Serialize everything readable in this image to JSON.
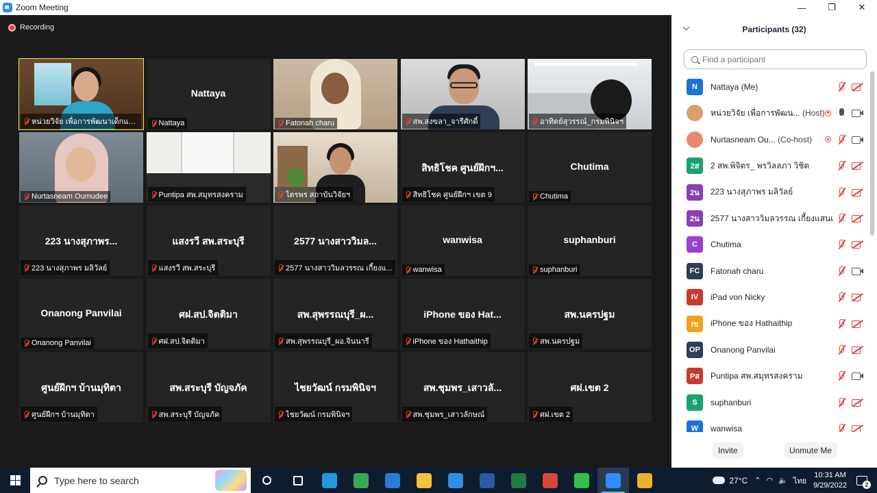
{
  "window": {
    "title": "Zoom Meeting",
    "controls": [
      "—",
      "❐",
      "✕"
    ]
  },
  "recording": {
    "label": "Recording"
  },
  "gallery": [
    {
      "big": "",
      "label": "หน่วยวิจัย เพื่อการพัฒนาเด็กและเยา...",
      "video": "v1"
    },
    {
      "big": "Nattaya",
      "label": "Nattaya",
      "video": ""
    },
    {
      "big": "",
      "label": "Fatonah charu",
      "video": "v3"
    },
    {
      "big": "",
      "label": "สพ.สงขลา_จารีศักดิ์",
      "video": "v4"
    },
    {
      "big": "",
      "label": "อาทิตย์สุวรรณ์_กรมพินิจฯ",
      "video": "v5"
    },
    {
      "big": "",
      "label": "Nurtasneam Oumudee",
      "video": "v6"
    },
    {
      "big": "",
      "label": "Puntipa สพ.สมุทรสงคราม",
      "video": "v7"
    },
    {
      "big": "",
      "label": "ไตรพร สถาบันวิจัยฯ",
      "video": "v8"
    },
    {
      "big": "สิทธิโชค ศูนย์ฝึกฯ...",
      "label": "สิทธิโชค ศูนย์ฝึกฯ เขต 9",
      "video": ""
    },
    {
      "big": "Chutima",
      "label": "Chutima",
      "video": ""
    },
    {
      "big": "223 นางสุภาพร...",
      "label": "223 นางสุภาพร  มลิวัลย์",
      "video": ""
    },
    {
      "big": "แสงรวี สพ.สระบุรี",
      "label": "แสงรวี สพ.สระบุรี",
      "video": ""
    },
    {
      "big": "2577 นางสาววิมล...",
      "label": "2577 นางสาววิมลวรรณ เกี้ยงแ...",
      "video": ""
    },
    {
      "big": "wanwisa",
      "label": "wanwisa",
      "video": ""
    },
    {
      "big": "suphanburi",
      "label": "suphanburi",
      "video": ""
    },
    {
      "big": "Onanong Panvilai",
      "label": "Onanong Panvilai",
      "video": ""
    },
    {
      "big": "ศฝ.สป.จิตติมา",
      "label": "ศฝ.สป.จิตติมา",
      "video": ""
    },
    {
      "big": "สพ.สุพรรณบุรี_ผ...",
      "label": "สพ.สุพรรณบุรี_ผอ.จินนารี",
      "video": ""
    },
    {
      "big": "iPhone ของ Hat...",
      "label": "iPhone ของ Hathaithip",
      "video": ""
    },
    {
      "big": "สพ.นครปฐม",
      "label": "สพ.นครปฐม",
      "video": ""
    },
    {
      "big": "ศูนย์ฝึกฯ บ้านมุทิตา",
      "label": "ศูนย์ฝึกฯ บ้านมุทิตา",
      "video": ""
    },
    {
      "big": "สพ.สระบุรี บัญจภัค",
      "label": "สพ.สระบุรี บัญจภัค",
      "video": ""
    },
    {
      "big": "ไชยวัฒน์ กรมพินิจฯ",
      "label": "ไชยวัฒน์ กรมพินิจฯ",
      "video": ""
    },
    {
      "big": "สพ.ชุมพร_เสาวลั...",
      "label": "สพ.ชุมพร_เสาวลักษณ์",
      "video": ""
    },
    {
      "big": "ศฝ.เขต 2",
      "label": "ศฝ.เขต 2",
      "video": ""
    }
  ],
  "participants": {
    "title": "Participants (32)",
    "search_placeholder": "Find a participant",
    "items": [
      {
        "avatar": "N",
        "color": "#1b72d8",
        "name": "Nattaya (Me)",
        "role": "",
        "rec": false,
        "mic": "muted",
        "cam": "off"
      },
      {
        "avatar": "",
        "color": "#d9a06b",
        "name": "หน่วยวิจัย เพื่อการพัฒน...",
        "role": "(Host)",
        "rec": true,
        "mic": "on",
        "cam": "on"
      },
      {
        "avatar": "",
        "color": "#e88a6a",
        "name": "Nurtasneam Ou...",
        "role": "(Co-host)",
        "rec": true,
        "mic": "muted",
        "cam": "on"
      },
      {
        "avatar": "2ส",
        "color": "#1aa36f",
        "name": "2 สพ.พิจิตร_ พรวิลลภา วิชิต",
        "role": "",
        "rec": false,
        "mic": "muted",
        "cam": "off"
      },
      {
        "avatar": "2น",
        "color": "#8a3fb5",
        "name": "223 นางสุภาพร  มลิวัลย์",
        "role": "",
        "rec": false,
        "mic": "muted",
        "cam": "off"
      },
      {
        "avatar": "2น",
        "color": "#8a3fb5",
        "name": "2577 นางสาววิมลวรรณ เกี้ยงแสนเมือง",
        "role": "",
        "rec": false,
        "mic": "muted",
        "cam": "off"
      },
      {
        "avatar": "C",
        "color": "#9a3fd0",
        "name": "Chutima",
        "role": "",
        "rec": false,
        "mic": "muted",
        "cam": "off"
      },
      {
        "avatar": "FC",
        "color": "#2d3e57",
        "name": "Fatonah charu",
        "role": "",
        "rec": false,
        "mic": "muted",
        "cam": "on"
      },
      {
        "avatar": "IV",
        "color": "#c93a2c",
        "name": "iPad von Nicky",
        "role": "",
        "rec": false,
        "mic": "muted",
        "cam": "off"
      },
      {
        "avatar": "Iข",
        "color": "#f0a21a",
        "name": "iPhone ของ Hathaithip",
        "role": "",
        "rec": false,
        "mic": "muted",
        "cam": "off"
      },
      {
        "avatar": "OP",
        "color": "#2d3e57",
        "name": "Onanong Panvilai",
        "role": "",
        "rec": false,
        "mic": "muted",
        "cam": "off"
      },
      {
        "avatar": "Pส",
        "color": "#c93a2c",
        "name": "Puntipa สพ.สมุทรสงคราม",
        "role": "",
        "rec": false,
        "mic": "muted",
        "cam": "on"
      },
      {
        "avatar": "S",
        "color": "#1aa36f",
        "name": "suphanburi",
        "role": "",
        "rec": false,
        "mic": "muted",
        "cam": "off"
      },
      {
        "avatar": "W",
        "color": "#1b72d8",
        "name": "wanwisa",
        "role": "",
        "rec": false,
        "mic": "muted",
        "cam": "off"
      }
    ],
    "invite_label": "Invite",
    "unmute_label": "Unmute Me"
  },
  "taskbar": {
    "search_placeholder": "Type here to search",
    "apps": [
      {
        "name": "edge-icon",
        "color": "#1f9ae0"
      },
      {
        "name": "chrome-icon",
        "color": "#3aa757"
      },
      {
        "name": "store-icon",
        "color": "#2b7bd6"
      },
      {
        "name": "file-explorer-icon",
        "color": "#f3c23d"
      },
      {
        "name": "mail-icon",
        "color": "#2f8fe0"
      },
      {
        "name": "word-icon",
        "color": "#2a5aa8"
      },
      {
        "name": "excel-icon",
        "color": "#1f7a44"
      },
      {
        "name": "chrome-profile-icon",
        "color": "#d6463b"
      },
      {
        "name": "line-icon",
        "color": "#2fc24a"
      },
      {
        "name": "zoom-icon",
        "color": "#2d8cff"
      },
      {
        "name": "chrome-icon-2",
        "color": "#e6b32a"
      }
    ],
    "temperature": "27°C",
    "language": "ไทย",
    "time": "10:31 AM",
    "date": "9/29/2022",
    "notification_count": "2"
  }
}
